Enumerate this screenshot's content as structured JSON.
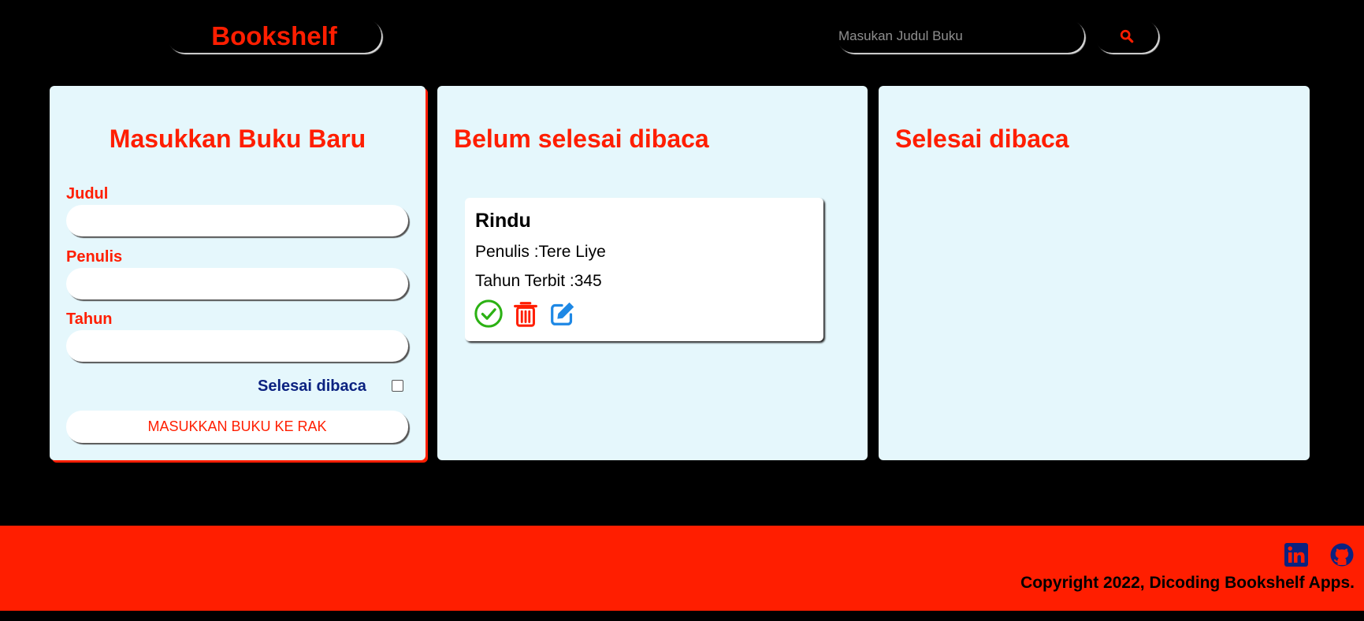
{
  "header": {
    "brand": "Bookshelf",
    "search": {
      "placeholder": "Masukan Judul Buku",
      "value": ""
    }
  },
  "form": {
    "title": "Masukkan Buku Baru",
    "fields": {
      "title_label": "Judul",
      "author_label": "Penulis",
      "year_label": "Tahun"
    },
    "complete_label": "Selesai dibaca",
    "complete_checked": false,
    "submit_label": "MASUKKAN BUKU KE RAK"
  },
  "shelves": {
    "incomplete_title": "Belum selesai dibaca",
    "complete_title": "Selesai dibaca",
    "incomplete_books": [
      {
        "title": "Rindu",
        "author_line": "Penulis :Tere Liye",
        "year_line": "Tahun Terbit :345"
      }
    ]
  },
  "footer": {
    "copyright": "Copyright 2022, Dicoding Bookshelf Apps.",
    "social_icons": [
      "linkedin-icon",
      "github-icon"
    ]
  },
  "colors": {
    "accent": "#ff1e00",
    "panel": "#e5f7fc",
    "check": "#2bb113",
    "edit": "#1e88e5",
    "navy": "#0b2280"
  }
}
